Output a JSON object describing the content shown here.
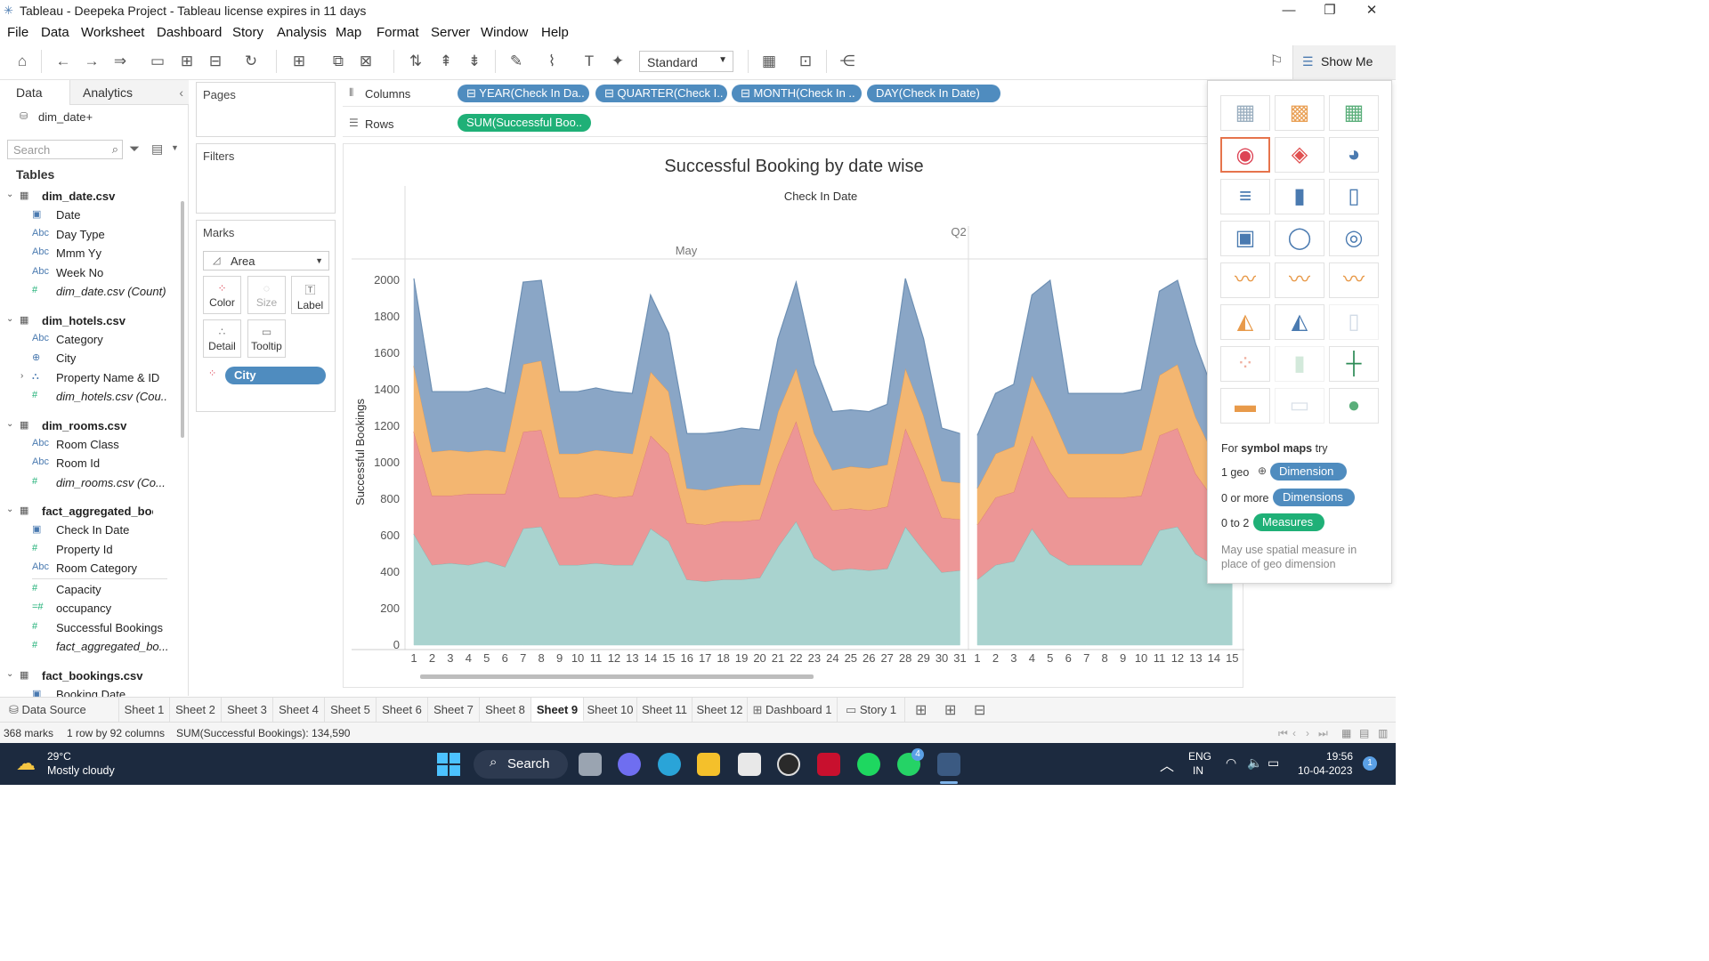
{
  "window": {
    "title": "Tableau - Deepeka Project - Tableau license expires in 11 days"
  },
  "menu": [
    "File",
    "Data",
    "Worksheet",
    "Dashboard",
    "Story",
    "Analysis",
    "Map",
    "Format",
    "Server",
    "Window",
    "Help"
  ],
  "toolbar": {
    "fit": "Standard",
    "show_me": "Show Me"
  },
  "left": {
    "tabs": [
      "Data",
      "Analytics"
    ],
    "datasource": "dim_date+",
    "search_placeholder": "Search",
    "tables_label": "Tables",
    "tables": [
      {
        "name": "dim_date.csv",
        "fields": [
          {
            "type": "date",
            "name": "Date"
          },
          {
            "type": "abc",
            "name": "Day Type"
          },
          {
            "type": "abc",
            "name": "Mmm Yy"
          },
          {
            "type": "abc",
            "name": "Week No"
          },
          {
            "type": "num",
            "name": "dim_date.csv (Count)",
            "italic": true
          }
        ]
      },
      {
        "name": "dim_hotels.csv",
        "fields": [
          {
            "type": "abc",
            "name": "Category"
          },
          {
            "type": "geo",
            "name": "City"
          },
          {
            "type": "hier",
            "name": "Property Name & ID"
          },
          {
            "type": "num",
            "name": "dim_hotels.csv (Cou...",
            "italic": true
          }
        ]
      },
      {
        "name": "dim_rooms.csv",
        "fields": [
          {
            "type": "abc",
            "name": "Room Class"
          },
          {
            "type": "abc",
            "name": "Room Id"
          },
          {
            "type": "num",
            "name": "dim_rooms.csv (Co...",
            "italic": true
          }
        ]
      },
      {
        "name": "fact_aggregated_boo...",
        "fields": [
          {
            "type": "date",
            "name": "Check In Date"
          },
          {
            "type": "num",
            "name": "Property Id"
          },
          {
            "type": "abc",
            "name": "Room Category"
          },
          {
            "type": "num",
            "name": "Capacity"
          },
          {
            "type": "calc",
            "name": "occupancy"
          },
          {
            "type": "num",
            "name": "Successful Bookings"
          },
          {
            "type": "num",
            "name": "fact_aggregated_bo...",
            "italic": true
          }
        ]
      },
      {
        "name": "fact_bookings.csv",
        "fields": [
          {
            "type": "date",
            "name": "Booking Date"
          }
        ]
      }
    ]
  },
  "cards": {
    "pages": "Pages",
    "filters": "Filters",
    "marks": "Marks",
    "mark_type": "Area",
    "buttons": [
      "Color",
      "Size",
      "Label",
      "Detail",
      "Tooltip"
    ],
    "color_pill": "City"
  },
  "shelves": {
    "columns_label": "Columns",
    "rows_label": "Rows",
    "columns": [
      "YEAR(Check In Da..",
      "QUARTER(Check I..",
      "MONTH(Check In ..",
      "DAY(Check In Date)"
    ],
    "rows": [
      "SUM(Successful Boo.."
    ]
  },
  "chart_data": {
    "type": "area",
    "title": "Successful Booking by date wise",
    "header": "Check In Date",
    "quarter_label": "Q2",
    "month_label": "May",
    "ylabel": "Successful Bookings",
    "ylim": [
      0,
      2100
    ],
    "yticks": [
      0,
      200,
      400,
      600,
      800,
      1000,
      1200,
      1400,
      1600,
      1800,
      2000
    ],
    "x": [
      1,
      2,
      3,
      4,
      5,
      6,
      7,
      8,
      9,
      10,
      11,
      12,
      13,
      14,
      15,
      16,
      17,
      18,
      19,
      20,
      21,
      22,
      23,
      24,
      25,
      26,
      27,
      28,
      29,
      30,
      31
    ],
    "x2": [
      1,
      2,
      3,
      4,
      5,
      6,
      7,
      8,
      9,
      10,
      11,
      12,
      13,
      14,
      15
    ],
    "colors": [
      "#a9d3cf",
      "#ec9696",
      "#f3b671",
      "#8aa6c6"
    ],
    "series": [
      {
        "values": [
          610,
          440,
          450,
          440,
          460,
          430,
          640,
          650,
          440,
          440,
          450,
          440,
          440,
          640,
          570,
          360,
          350,
          360,
          360,
          370,
          540,
          680,
          480,
          410,
          420,
          410,
          420,
          650,
          520,
          400,
          410
        ]
      },
      {
        "values": [
          560,
          380,
          370,
          390,
          370,
          400,
          530,
          530,
          370,
          370,
          380,
          370,
          380,
          510,
          480,
          310,
          310,
          320,
          320,
          320,
          450,
          550,
          420,
          330,
          330,
          330,
          340,
          540,
          440,
          300,
          280
        ]
      },
      {
        "values": [
          360,
          240,
          250,
          230,
          240,
          230,
          370,
          380,
          240,
          240,
          240,
          250,
          230,
          350,
          340,
          190,
          190,
          190,
          200,
          190,
          290,
          290,
          260,
          220,
          230,
          230,
          230,
          330,
          300,
          200,
          200
        ]
      },
      {
        "values": [
          480,
          330,
          320,
          330,
          340,
          320,
          450,
          440,
          340,
          340,
          340,
          330,
          330,
          420,
          320,
          300,
          310,
          300,
          310,
          300,
          400,
          470,
          380,
          320,
          310,
          310,
          330,
          490,
          420,
          290,
          270
        ]
      }
    ],
    "series2": [
      {
        "values": [
          360,
          440,
          460,
          640,
          500,
          440,
          440,
          440,
          440,
          440,
          630,
          650,
          500,
          440,
          440
        ]
      },
      {
        "values": [
          300,
          370,
          380,
          510,
          450,
          370,
          370,
          370,
          370,
          380,
          520,
          540,
          440,
          360,
          370
        ]
      },
      {
        "values": [
          200,
          240,
          250,
          330,
          330,
          240,
          240,
          240,
          240,
          250,
          330,
          350,
          310,
          240,
          240
        ]
      },
      {
        "values": [
          290,
          330,
          340,
          440,
          720,
          330,
          330,
          330,
          330,
          330,
          460,
          460,
          400,
          340,
          350
        ]
      }
    ]
  },
  "showme": {
    "hint_prefix": "For ",
    "hint_bold": "symbol maps",
    "hint_suffix": " try",
    "req1": "1 geo",
    "pill1": "Dimension",
    "req2": "0 or more",
    "pill2": "Dimensions",
    "req3": "0 to 2",
    "pill3": "Measures",
    "note": "May use spatial measure in place of geo dimension"
  },
  "sheet_tabs": [
    "Data Source",
    "Sheet 1",
    "Sheet 2",
    "Sheet 3",
    "Sheet 4",
    "Sheet 5",
    "Sheet 6",
    "Sheet 7",
    "Sheet 8",
    "Sheet 9",
    "Sheet 10",
    "Sheet 11",
    "Sheet 12",
    "Dashboard 1",
    "Story 1"
  ],
  "active_tab": "Sheet 9",
  "status": {
    "marks": "368 marks",
    "dims": "1 row by 92 columns",
    "sum": "SUM(Successful Bookings): 134,590"
  },
  "taskbar": {
    "temp": "29°C",
    "weather": "Mostly cloudy",
    "search": "Search",
    "lang1": "ENG",
    "lang2": "IN",
    "time": "19:56",
    "date": "10-04-2023",
    "badge": "4",
    "notif": "1"
  }
}
